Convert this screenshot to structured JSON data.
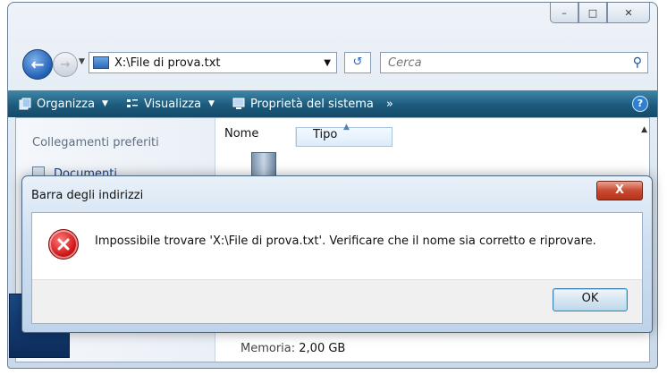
{
  "window": {
    "controls": {
      "minimize": "–",
      "maximize": "□",
      "close": "✕"
    }
  },
  "nav": {
    "address": "X:\\File di prova.txt",
    "search_placeholder": "Cerca"
  },
  "toolbar": {
    "organize": "Organizza",
    "views": "Visualizza",
    "system_properties": "Proprietà del sistema",
    "overflow": "»",
    "help": "?"
  },
  "navpane": {
    "header": "Collegamenti preferiti",
    "documents": "Documenti"
  },
  "columns": {
    "name": "Nome",
    "type": "Tipo"
  },
  "details": {
    "memory_label": "Memoria:",
    "memory_value": "2,00 GB"
  },
  "dialog": {
    "title": "Barra degli indirizzi",
    "message": "Impossibile trovare 'X:\\File di prova.txt'. Verificare che il nome sia corretto e riprovare.",
    "ok": "OK",
    "close": "X"
  },
  "colors": {
    "toolbar": "#1d5b7d",
    "error_red": "#d01616",
    "ok_border": "#3c7fb1"
  }
}
